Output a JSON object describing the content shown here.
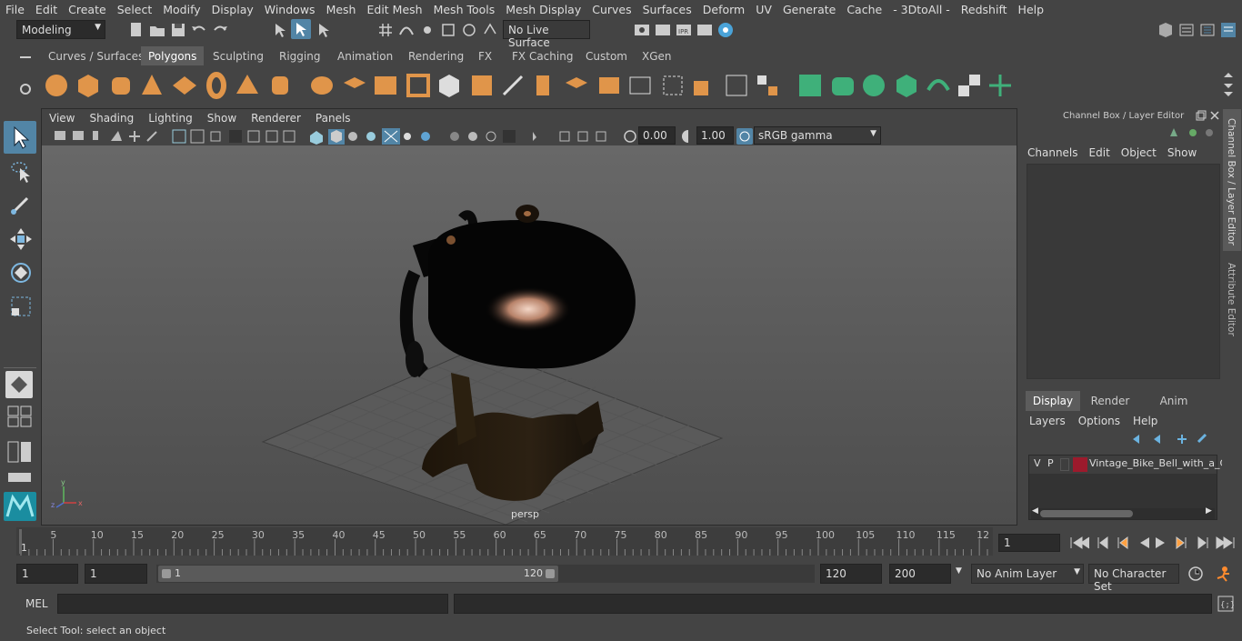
{
  "menubar": {
    "items": [
      "File",
      "Edit",
      "Create",
      "Select",
      "Modify",
      "Display",
      "Windows",
      "Mesh",
      "Edit Mesh",
      "Mesh Tools",
      "Mesh Display",
      "Curves",
      "Surfaces",
      "Deform",
      "UV",
      "Generate",
      "Cache",
      "- 3DtoAll -",
      "Redshift",
      "Help"
    ]
  },
  "status": {
    "mode": "Modeling",
    "live_surface": "No Live Surface"
  },
  "shelf": {
    "tabs": [
      "Curves / Surfaces",
      "Polygons",
      "Sculpting",
      "Rigging",
      "Animation",
      "Rendering",
      "FX",
      "FX Caching",
      "Custom",
      "XGen"
    ],
    "active_tab": "Polygons"
  },
  "viewport": {
    "menu": [
      "View",
      "Shading",
      "Lighting",
      "Show",
      "Renderer",
      "Panels"
    ],
    "exposure": "0.00",
    "gamma": "1.00",
    "color_space": "sRGB gamma",
    "camera_label": "persp"
  },
  "channel_box": {
    "title": "Channel Box / Layer Editor",
    "menu": [
      "Channels",
      "Edit",
      "Object",
      "Show"
    ],
    "layer_tabs": [
      "Display",
      "Render",
      "Anim"
    ],
    "active_layer_tab": "Display",
    "layer_menu": [
      "Layers",
      "Options",
      "Help"
    ],
    "layer": {
      "v": "V",
      "p": "P",
      "color": "#9c1a2c",
      "name": "Vintage_Bike_Bell_with_a_C"
    }
  },
  "side_tabs": [
    "Channel Box / Layer Editor",
    "Attribute Editor"
  ],
  "timeline": {
    "ticks": [
      "5",
      "10",
      "15",
      "20",
      "25",
      "30",
      "35",
      "40",
      "45",
      "50",
      "55",
      "60",
      "65",
      "70",
      "75",
      "80",
      "85",
      "90",
      "95",
      "100",
      "105",
      "110",
      "115",
      "12"
    ],
    "start_marker": "1",
    "current_frame": "1"
  },
  "range": {
    "start": "1",
    "playback_start": "1",
    "slider_start": "1",
    "slider_end": "120",
    "playback_end": "120",
    "end": "200",
    "anim_layer": "No Anim Layer",
    "character_set": "No Character Set"
  },
  "mel": {
    "label": "MEL"
  },
  "help": {
    "text": "Select Tool: select an object"
  },
  "colors": {
    "accent": "#5285a6",
    "poly_icon": "#e0954a",
    "green_icon": "#3fb07a"
  }
}
